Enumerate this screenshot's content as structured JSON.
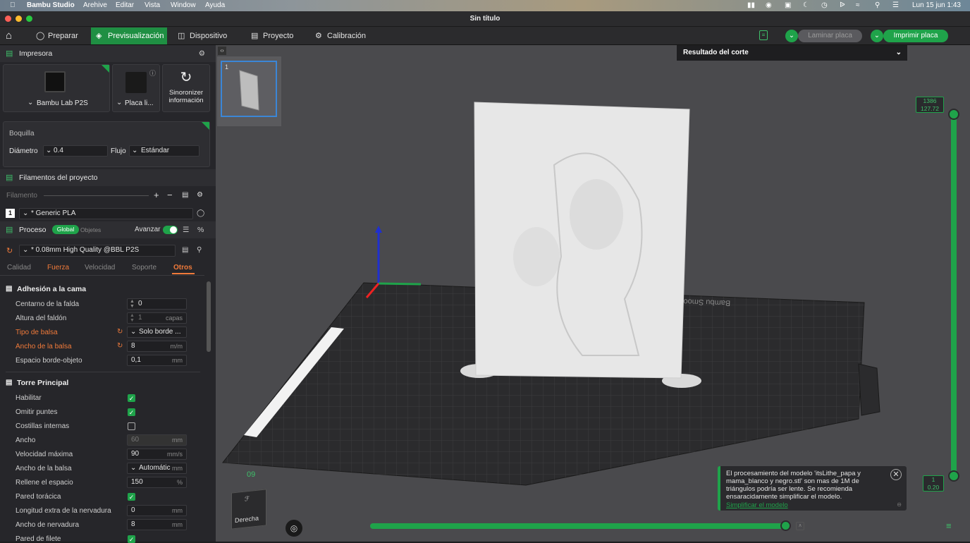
{
  "menubar": {
    "app": "Bambu Studio",
    "items": [
      "Arehive",
      "Editar",
      "Vista",
      "Window",
      "Ayuda"
    ],
    "clock": "Lun 15 jun 1:43"
  },
  "window": {
    "title": "Sin título"
  },
  "toolbar": {
    "tabs": [
      "Preparar",
      "Previsualización",
      "Dispositivo",
      "Proyecto",
      "Calibración"
    ],
    "active_tab": "Previsualización",
    "slice_label": "Laminar placa",
    "print_label": "Imprimir placa"
  },
  "printer": {
    "section_title": "Impresora",
    "printer_name": "Bambu Lab P2S",
    "plate_name": "Placa li...",
    "sync_label": "Sinoronizer información",
    "nozzle_title": "Boquilla",
    "diameter_label": "Diámetro",
    "diameter_value": "0.4",
    "flow_label": "Flujo",
    "flow_value": "Estándar"
  },
  "filaments": {
    "section_title": "Filamentos del proyecto",
    "filament_label": "Filamento",
    "slot": "1",
    "name": "* Generic PLA"
  },
  "process": {
    "title": "Proceso",
    "global_label": "Global",
    "objects_label": "Objetes",
    "advanced_label": "Avanzar",
    "preset": "* 0.08mm High Quality @BBL P2S",
    "tabs": [
      "Calidad",
      "Fuerza",
      "Velocidad",
      "Soporte",
      "Otros"
    ],
    "active_tab": "Otros"
  },
  "bed_adhesion": {
    "title": "Adhesión a la cama",
    "rows": [
      {
        "label": "Centarno de la falda",
        "value": "0",
        "unit": ""
      },
      {
        "label": "Altura del faldón",
        "value": "1",
        "unit": "capas"
      },
      {
        "label": "Tipo de balsa",
        "value": "Solo borde ...",
        "unit": ""
      },
      {
        "label": "Ancho de la balsa",
        "value": "8",
        "unit": "m/m"
      },
      {
        "label": "Espacio borde-objeto",
        "value": "0,1",
        "unit": "mm"
      }
    ]
  },
  "prime_tower": {
    "title": "Torre Principal",
    "enable": "Habilitar",
    "skip_points": "Omitir puntes",
    "internal_ribs": "Costillas internas",
    "width_label": "Ancho",
    "width_value": "60",
    "width_unit": "mm",
    "max_speed_label": "Velocidad máxima",
    "max_speed_value": "90",
    "max_speed_unit": "mm/s",
    "brim_label": "Ancho de la balsa",
    "brim_value": "Automátic",
    "brim_unit": "mm",
    "infill_gap_label": "Rellene el espacio",
    "infill_gap_value": "150",
    "infill_gap_unit": "%",
    "rib_wall_label": "Pared torácica",
    "extra_rib_label": "Longitud extra de la nervadura",
    "extra_rib_value": "0",
    "extra_rib_unit": "mm",
    "rib_width_label": "Ancho de nervadura",
    "rib_width_value": "8",
    "rib_width_unit": "mm",
    "fillet_label": "Pared de filete"
  },
  "viewport": {
    "plate_number": "1",
    "result_title": "Resultado del corte",
    "layer_top": "1386",
    "layer_top_height": "127.72",
    "layer_bottom": "1",
    "layer_bottom_height": "0.20",
    "cube_label": "Derecha",
    "bed_brand": "Bambu Smooth",
    "notice_text": "El procesamiento del modelo 'itsLithe_papa y mama_blanco y negro.stl' son mas de 1M de triángulos podría ser lente. Se recomienda ensaracidamente simplificar el modelo.",
    "notice_link": "Simplificar el modelo"
  },
  "colors": {
    "accent": "#1fa34a",
    "warning": "#f07a3a"
  }
}
